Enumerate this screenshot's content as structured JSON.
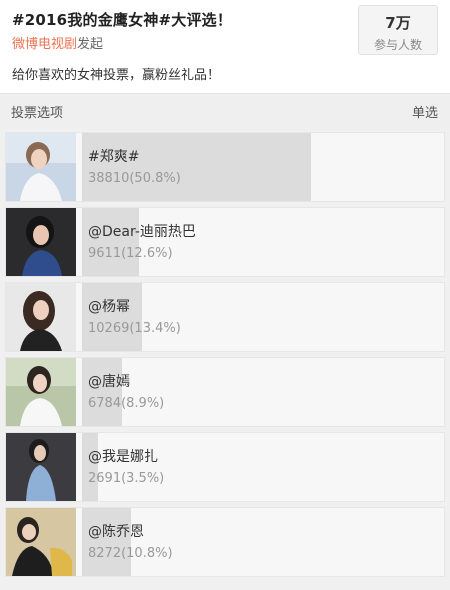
{
  "header": {
    "title": "#2016我的金鹰女神#大评选！",
    "account": "微博电视剧",
    "action": "发起",
    "description": "给你喜欢的女神投票，赢粉丝礼品！",
    "participants_value": "7万",
    "participants_label": "参与人数"
  },
  "options_header": {
    "label": "投票选项",
    "mode": "单选"
  },
  "options": [
    {
      "name": "#郑爽#",
      "votes": "38810(50.8%)",
      "share": 0.508
    },
    {
      "name": "@Dear-迪丽热巴",
      "votes": "9611(12.6%)",
      "share": 0.126
    },
    {
      "name": "@杨幂",
      "votes": "10269(13.4%)",
      "share": 0.134
    },
    {
      "name": "@唐嫣",
      "votes": "6784(8.9%)",
      "share": 0.089
    },
    {
      "name": "@我是娜扎",
      "votes": "2691(3.5%)",
      "share": 0.035
    },
    {
      "name": "@陈乔恩",
      "votes": "8272(10.8%)",
      "share": 0.108
    }
  ]
}
